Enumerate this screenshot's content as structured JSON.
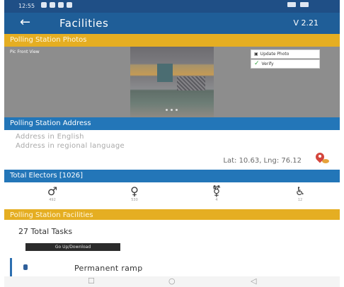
{
  "status_bar": {
    "time": "12:55"
  },
  "app_bar": {
    "back_icon": "back-arrow-icon",
    "title": "Facilities",
    "version": "V 2.21"
  },
  "photos": {
    "header": "Polling Station Photos",
    "caption": "Pic Front View",
    "update_label": "Update Photo",
    "verify_label": "Verify"
  },
  "address": {
    "header": "Polling Station Address",
    "english": "Address in English",
    "regional": "Address in regional language",
    "latlng": "Lat: 10.63, Lng: 76.12"
  },
  "electors": {
    "header": "Total Electors [1026]",
    "items": [
      {
        "icon": "male-icon",
        "count": "492"
      },
      {
        "icon": "female-icon",
        "count": "530"
      },
      {
        "icon": "third-gender-icon",
        "count": "4"
      },
      {
        "icon": "wheelchair-icon",
        "count": "12"
      }
    ]
  },
  "facilities": {
    "header": "Polling Station Facilities",
    "total_tasks": "27 Total Tasks",
    "button_label": "Go Up/Download",
    "tasks": [
      {
        "label": "Permanent ramp"
      }
    ]
  },
  "nav": {
    "recents": "☐",
    "home": "○",
    "back": "◁"
  },
  "colors": {
    "primary": "#1f5e98",
    "section_blue": "#2376b8",
    "accent_yellow": "#e5ae22"
  }
}
